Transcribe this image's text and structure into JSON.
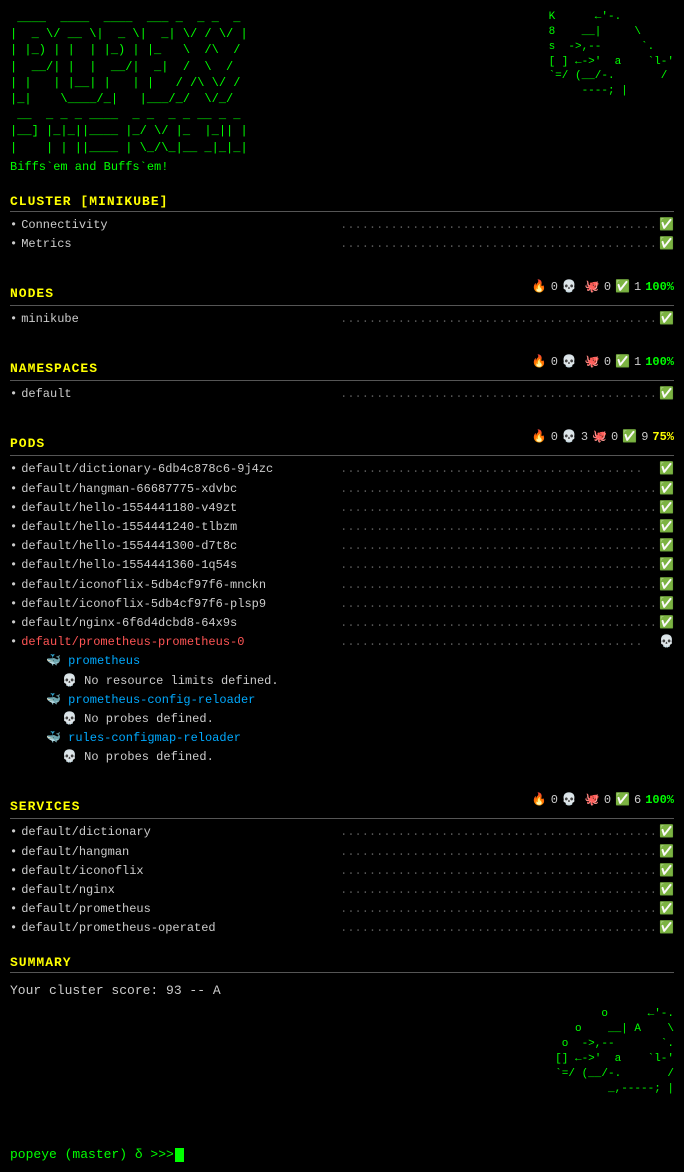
{
  "header": {
    "logo_left": " ____  ____ ____  _______   _____\n|  _ \\/ __ \\ __ \\|  ____\\ \\ / ____|\n| |_) | |  | |__) | |__   \\ \\ /___ \n|  __/| |  |  ___/|  __|   \\ \\___  \\\n| |   | |__| |    | |____ __\\ \\___\\ \\\n|_|    \\____/_|    |______\\____\\____/\n  __   __   _ _  _  _ _ _  _   _ _\n |__|  |  | |_/ |_|\\  |_  |  | |_|\n |     |__| |   | |  _|__ |__| |\n Biffs`em and Buffs`em!",
    "logo_right": "        K      ←'-.     \n        8    __|     \\  \n        s  ->,--      `. \n        [ ] ←->'  a    `l-'\n        `=/ (__/-.       / \n             ----; |    ",
    "tagline": "Biffs`em and Buffs`em!"
  },
  "cluster": {
    "label": "CLUSTER  [MINIKUBE]",
    "items": [
      {
        "name": "Connectivity",
        "dots": "........................................................................",
        "status": "✅"
      },
      {
        "name": "Metrics",
        "dots": "...........................................................................",
        "status": "✅"
      }
    ]
  },
  "nodes": {
    "label": "NODES",
    "badges": {
      "fire": "🔥",
      "fire_count": "0",
      "skull": "💀",
      "skull_count": "",
      "ghost": "🐙",
      "ghost_count": "0",
      "ok": "✅",
      "ok_count": "1",
      "pct": "100%",
      "pct_class": "pct-green"
    },
    "items": [
      {
        "name": "minikube",
        "dots": "...........................................................................",
        "status": "✅",
        "warn": false
      }
    ]
  },
  "namespaces": {
    "label": "NAMESPACES",
    "badges": {
      "fire": "🔥",
      "fire_count": "0",
      "skull": "💀",
      "skull_count": "",
      "ghost": "🐙",
      "ghost_count": "0",
      "ok": "✅",
      "ok_count": "1",
      "pct": "100%",
      "pct_class": "pct-green"
    },
    "items": [
      {
        "name": "default",
        "dots": ".............................................................................",
        "status": "✅",
        "warn": false
      }
    ]
  },
  "pods": {
    "label": "PODS",
    "badges": {
      "fire": "🔥",
      "fire_count": "0",
      "skull": "💀",
      "skull_count": "3",
      "ghost": "🐙",
      "ghost_count": "0",
      "ok": "✅",
      "ok_count": "9",
      "pct": "75%",
      "pct_class": "pct-yellow"
    },
    "items": [
      {
        "name": "default/dictionary-6db4c878c6-9j4zc",
        "dots": "...........................",
        "status": "✅",
        "warn": false
      },
      {
        "name": "default/hangman-66687775-xdvbc",
        "dots": ".....................................",
        "status": "✅",
        "warn": false
      },
      {
        "name": "default/hello-1554441180-v49zt",
        "dots": ".....................................",
        "status": "✅",
        "warn": false
      },
      {
        "name": "default/hello-1554441240-tlbzm",
        "dots": "....................................",
        "status": "✅",
        "warn": false
      },
      {
        "name": "default/hello-1554441300-d7t8c",
        "dots": ".....................................",
        "status": "✅",
        "warn": false
      },
      {
        "name": "default/hello-1554441360-1q54s",
        "dots": ".....................................",
        "status": "✅",
        "warn": false
      },
      {
        "name": "default/iconoflix-5db4cf97f6-mnckn",
        "dots": "..................................",
        "status": "✅",
        "warn": false
      },
      {
        "name": "default/iconoflix-5db4cf97f6-plsp9",
        "dots": "..................................",
        "status": "✅",
        "warn": false
      },
      {
        "name": "default/nginx-6f6d4dcbd8-64x9s",
        "dots": "....................................",
        "status": "✅",
        "warn": false
      },
      {
        "name": "default/prometheus-prometheus-0",
        "dots": "...................................",
        "status": "💀",
        "warn": true,
        "sub_items": [
          {
            "icon": "🐳",
            "text": "prometheus"
          },
          {
            "warn_icon": "💀",
            "text": "No resource limits defined."
          },
          {
            "icon": "🐳",
            "text": "prometheus-config-reloader"
          },
          {
            "warn_icon": "💀",
            "text": "No probes defined."
          },
          {
            "icon": "🐳",
            "text": "rules-configmap-reloader"
          },
          {
            "warn_icon": "💀",
            "text": "No probes defined."
          }
        ]
      }
    ]
  },
  "services": {
    "label": "SERVICES",
    "badges": {
      "fire": "🔥",
      "fire_count": "0",
      "skull": "💀",
      "skull_count": "",
      "ghost": "🐙",
      "ghost_count": "0",
      "ok": "✅",
      "ok_count": "6",
      "pct": "100%",
      "pct_class": "pct-green"
    },
    "items": [
      {
        "name": "default/dictionary",
        "dots": "......................................................................",
        "status": "✅",
        "warn": false
      },
      {
        "name": "default/hangman",
        "dots": "........................................................................",
        "status": "✅",
        "warn": false
      },
      {
        "name": "default/iconoflix",
        "dots": ".......................................................................",
        "status": "✅",
        "warn": false
      },
      {
        "name": "default/nginx",
        "dots": "...........................................................................",
        "status": "✅",
        "warn": false
      },
      {
        "name": "default/prometheus",
        "dots": ".....................................................................",
        "status": "✅",
        "warn": false
      },
      {
        "name": "default/prometheus-operated",
        "dots": ".............................................................",
        "status": "✅",
        "warn": false
      }
    ]
  },
  "summary": {
    "label": "SUMMARY",
    "score_text": "Your cluster score: 93 -- A",
    "ascii_art": "        o      ←'-.     \n        o    __| A    \\\n        o  ->,--       `.\n        [] ←->'  a    `l-'\n        `=/ (__/-.       /\n          _,-----; |   "
  },
  "prompt": {
    "text": "popeye (master) δ >>>"
  }
}
